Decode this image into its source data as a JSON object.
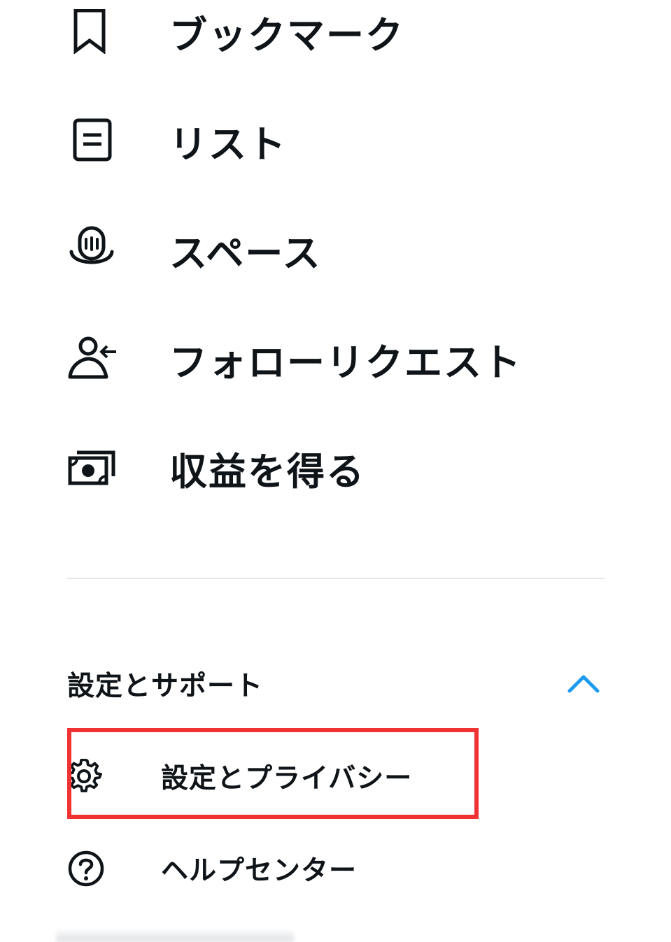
{
  "menu": {
    "items": [
      {
        "label": "ブックマーク",
        "icon": "bookmark-icon"
      },
      {
        "label": "リスト",
        "icon": "list-icon"
      },
      {
        "label": "スペース",
        "icon": "spaces-microphone-icon"
      },
      {
        "label": "フォローリクエスト",
        "icon": "follow-request-icon"
      },
      {
        "label": "収益を得る",
        "icon": "monetization-money-icon"
      }
    ]
  },
  "settings_support": {
    "title": "設定とサポート",
    "expanded": true,
    "toggle_icon": "chevron-up-icon",
    "items": [
      {
        "label": "設定とプライバシー",
        "icon": "gear-icon",
        "highlighted": true
      },
      {
        "label": "ヘルプセンター",
        "icon": "help-question-icon"
      }
    ]
  },
  "colors": {
    "text": "#0f1419",
    "accent": "#1d9bf0",
    "divider": "#e6e9eb",
    "highlight_border": "#f03232",
    "background": "#ffffff"
  }
}
